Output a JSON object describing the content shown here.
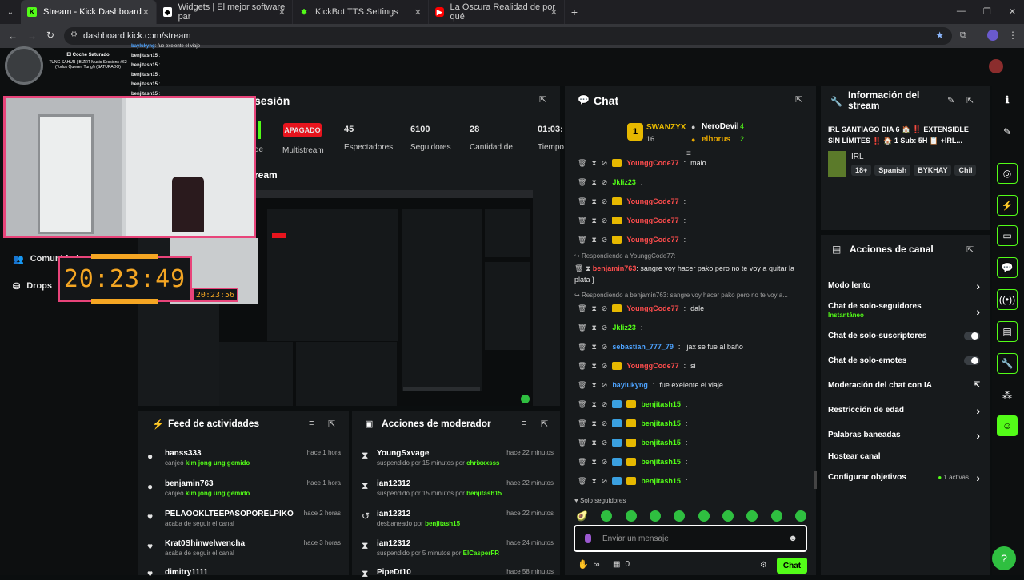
{
  "browser": {
    "tabs": [
      {
        "label": "Stream - Kick Dashboard",
        "icon": "kick-icon",
        "color": "#53fc18"
      },
      {
        "label": "Widgets | El mejor software par",
        "icon": "widget-icon",
        "color": "#ffffff"
      },
      {
        "label": "KickBot TTS Settings",
        "icon": "kickbot-icon",
        "color": "#53fc18"
      },
      {
        "label": "La Oscura Realidad de por qué",
        "icon": "youtube-icon",
        "color": "#ff0000"
      }
    ],
    "url": "dashboard.kick.com/stream"
  },
  "overlay": {
    "song_title": "El Coche Saturado",
    "song_sub": "TUNG SAHUR | BIZRT Music Sessions #62 (Todos Quieren Tung!) (SATURADO)",
    "mini_chat": [
      {
        "user": "baylukyng",
        "msg": "fue exelente el viaje"
      },
      {
        "user": "benjitash15",
        "msg": ""
      },
      {
        "user": "benjitash15",
        "msg": ""
      },
      {
        "user": "benjitash15",
        "msg": ""
      },
      {
        "user": "benjitash15",
        "msg": ""
      },
      {
        "user": "benjitash15",
        "msg": ""
      }
    ],
    "clock": "20:23:49",
    "clock_small": "20:23:56"
  },
  "sidebar": {
    "items": [
      {
        "label": "Comunidad",
        "icon": "community-icon"
      },
      {
        "label": "Drops",
        "icon": "drops-icon"
      }
    ]
  },
  "session": {
    "title": "sesión",
    "stream_title": "ream",
    "stats": [
      {
        "value": "APAGADO",
        "label": "Multistream"
      },
      {
        "value": "45",
        "label": "Espectadores"
      },
      {
        "value": "6100",
        "label": "Seguidores"
      },
      {
        "value": "28",
        "label": "Cantidad de"
      },
      {
        "value": "01:03:",
        "label": "Tiempo"
      }
    ],
    "partial_label": "de"
  },
  "chat": {
    "title": "Chat",
    "top_gifters": [
      {
        "rank": "1",
        "name": "SWANZYX",
        "count": "16"
      },
      {
        "name": "NeroDevil",
        "count": "4"
      },
      {
        "name": "elhorus",
        "count": "2"
      }
    ],
    "messages": [
      {
        "user": "YounggCode77",
        "text": "malo",
        "color": "#ff4d4d",
        "badges": "y"
      },
      {
        "user": "Jkliz23",
        "text": "",
        "color": "#53fc18",
        "badges": ""
      },
      {
        "user": "YounggCode77",
        "text": "",
        "color": "#ff4d4d",
        "badges": "y"
      },
      {
        "user": "YounggCode77",
        "text": "",
        "color": "#ff4d4d",
        "badges": "y"
      },
      {
        "user": "YounggCode77",
        "text": "",
        "color": "#ff4d4d",
        "badges": "y"
      }
    ],
    "reply1_header": "Respondiendo a YounggCode77:",
    "reply1_user": "benjamin763",
    "reply1_text": "sangre voy hacer pako pero no te voy a quitar la plata }",
    "reply2_header": "Respondiendo a benjamin763: sangre voy hacer pako pero no te voy a...",
    "messages2": [
      {
        "user": "YounggCode77",
        "text": "dale",
        "color": "#ff4d4d",
        "badges": "y"
      },
      {
        "user": "Jkliz23",
        "text": "",
        "color": "#53fc18",
        "badges": ""
      },
      {
        "user": "sebastian_777_79",
        "text": "ljax se fue al baño",
        "color": "#4da3ff",
        "badges": ""
      },
      {
        "user": "YounggCode77",
        "text": "si",
        "color": "#ff4d4d",
        "badges": "y"
      },
      {
        "user": "baylukyng",
        "text": "fue exelente el viaje",
        "color": "#4da3ff",
        "badges": ""
      },
      {
        "user": "benjitash15",
        "text": "",
        "color": "#53fc18",
        "badges": "by"
      },
      {
        "user": "benjitash15",
        "text": "",
        "color": "#53fc18",
        "badges": "by"
      },
      {
        "user": "benjitash15",
        "text": "",
        "color": "#53fc18",
        "badges": "by"
      },
      {
        "user": "benjitash15",
        "text": "",
        "color": "#53fc18",
        "badges": "by"
      },
      {
        "user": "benjitash15",
        "text": "",
        "color": "#53fc18",
        "badges": "by"
      }
    ],
    "followers_only": "Solo seguidores",
    "input_placeholder": "Enviar un mensaje",
    "points": "0",
    "send_label": "Chat"
  },
  "info": {
    "title_line1": "Información del",
    "title_line2": "stream",
    "stream_title": "IRL SANTIAGO DIA 6 🏠 ‼️ EXTENSIBLE SIN LÍMITES ‼️ 🏠 1 Sub: 5H 📋 +IRL...",
    "category": "IRL",
    "tags": [
      "18+",
      "Spanish",
      "BYKHAY",
      "Chil"
    ]
  },
  "channel_actions": {
    "title": "Acciones de canal",
    "items": [
      {
        "label": "Modo lento",
        "sub": "",
        "control": "arrow"
      },
      {
        "label": "Chat de solo-seguidores",
        "sub": "Instantáneo",
        "control": "arrow"
      },
      {
        "label": "Chat de solo-suscriptores",
        "sub": "",
        "control": "toggle"
      },
      {
        "label": "Chat de solo-emotes",
        "sub": "",
        "control": "toggle"
      },
      {
        "label": "Moderación del chat con IA",
        "sub": "",
        "control": "external"
      },
      {
        "label": "Restricción de edad",
        "sub": "",
        "control": "arrow"
      },
      {
        "label": "Palabras baneadas",
        "sub": "",
        "control": "arrow"
      },
      {
        "label": "Hostear canal",
        "sub": "",
        "control": "none"
      },
      {
        "label": "Configurar objetivos",
        "sub": "1 activas",
        "control": "arrow"
      }
    ]
  },
  "feed": {
    "title": "Feed de actividades",
    "items": [
      {
        "user": "hanss333",
        "action": "canjeó",
        "reward": "kim jong ung gemido",
        "time": "hace 1 hora",
        "icon": "points-icon"
      },
      {
        "user": "benjamin763",
        "action": "canjeó",
        "reward": "kim jong ung gemido",
        "time": "hace 1 hora",
        "icon": "points-icon"
      },
      {
        "user": "PELAOOKLTEEPASOPORELPIKO",
        "action": "acaba de seguir el canal",
        "reward": "",
        "time": "hace 2 horas",
        "icon": "heart-icon"
      },
      {
        "user": "Krat0Shinwelwencha",
        "action": "acaba de seguir el canal",
        "reward": "",
        "time": "hace 3 horas",
        "icon": "heart-icon"
      },
      {
        "user": "dimitry1111",
        "action": "",
        "reward": "",
        "time": "hace 3 horas",
        "icon": "heart-icon"
      }
    ]
  },
  "modactions": {
    "title": "Acciones de moderador",
    "items": [
      {
        "user": "YoungSxvage",
        "action": "suspendido por 15 minutos por",
        "by": "chrixxxsss",
        "time": "hace 22 minutos",
        "icon": "hourglass-icon"
      },
      {
        "user": "ian12312",
        "action": "suspendido por 15 minutos por",
        "by": "benjitash15",
        "time": "hace 22 minutos",
        "icon": "hourglass-icon"
      },
      {
        "user": "ian12312",
        "action": "desbaneado por",
        "by": "benjitash15",
        "time": "hace 22 minutos",
        "icon": "unban-icon"
      },
      {
        "user": "ian12312",
        "action": "suspendido por 5 minutos por",
        "by": "ElCasperFR",
        "time": "hace 24 minutos",
        "icon": "hourglass-icon"
      },
      {
        "user": "PipeDt10",
        "action": "",
        "by": "",
        "time": "hace 58 minutos",
        "icon": "hourglass-icon"
      }
    ]
  },
  "colors": {
    "kick_green": "#53fc18",
    "panel": "#171a1c",
    "bg": "#0b0e0f",
    "red": "#e8141d"
  }
}
